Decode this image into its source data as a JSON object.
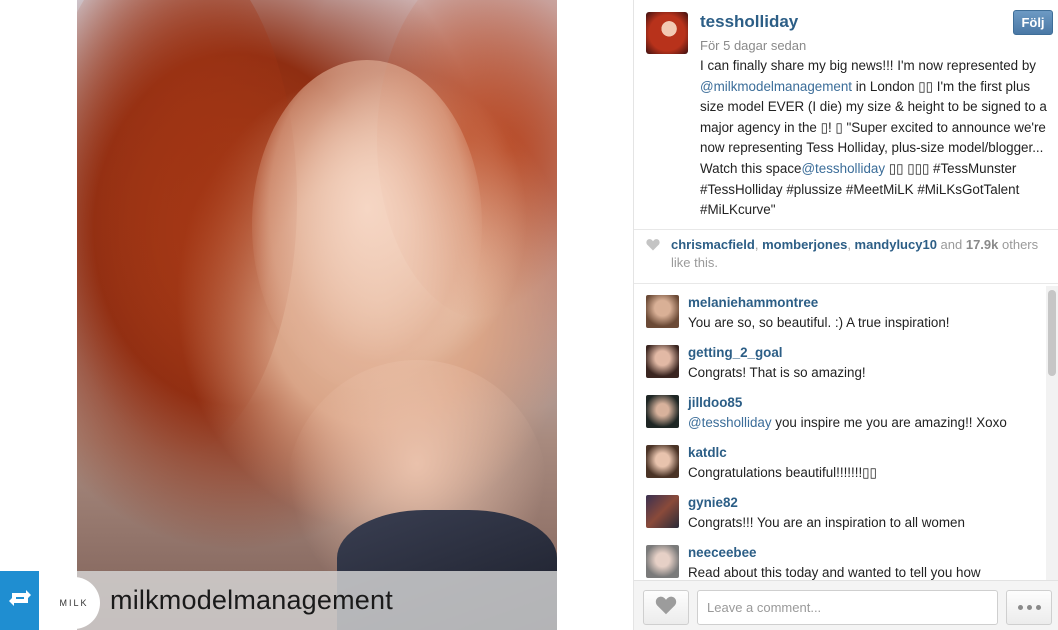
{
  "repost": {
    "account": "milkmodelmanagement",
    "logo_text": "MILK"
  },
  "post": {
    "author": "tessholliday",
    "follow_label": "Följ",
    "time": "För 5 dagar sedan",
    "caption": {
      "p1": "I can finally share my big news!!! I'm now represented by ",
      "mention1": "@milkmodelmanagement",
      "p2": " in London ▯▯ I'm the first plus size model EVER (I die) my size & height to be signed to a major agency in the ▯! ▯ \"Super excited to announce we're now representing Tess Holliday, plus-size model/blogger... Watch this space",
      "mention2": "@tessholliday",
      "p3": " ▯▯ ▯▯▯ #TessMunster #TessHolliday #plussize #MeetMiLK #MiLKsGotTalent #MiLKcurve\""
    }
  },
  "likes": {
    "user1": "chrismacfield",
    "sep1": ", ",
    "user2": "momberjones",
    "sep2": ", ",
    "user3": "mandylucy10",
    "and": " and ",
    "count": "17.9k",
    "tail": " others like this."
  },
  "comments": [
    {
      "user": "melaniehammontree",
      "text": "You are so, so beautiful. :) A true inspiration!"
    },
    {
      "user": "getting_2_goal",
      "text": "Congrats! That is so amazing!"
    },
    {
      "user": "jilldoo85",
      "mention": "@tessholliday",
      "text": " you inspire me you are amazing!! Xoxo"
    },
    {
      "user": "katdlc",
      "text": "Congratulations beautiful!!!!!!!▯▯"
    },
    {
      "user": "gynie82",
      "text": "Congrats!!! You are an inspiration to all women"
    },
    {
      "user": "neeceebee",
      "text": "Read about this today and wanted to tell you how"
    }
  ],
  "comment_box": {
    "placeholder": "Leave a comment..."
  },
  "icons": {
    "repost": "repost-icon",
    "heart": "heart-icon",
    "more": "more-dots-icon"
  },
  "colors": {
    "accent": "#2c5e86",
    "repost_badge": "#1f8ed1",
    "follow_button": "#5a88b5"
  }
}
